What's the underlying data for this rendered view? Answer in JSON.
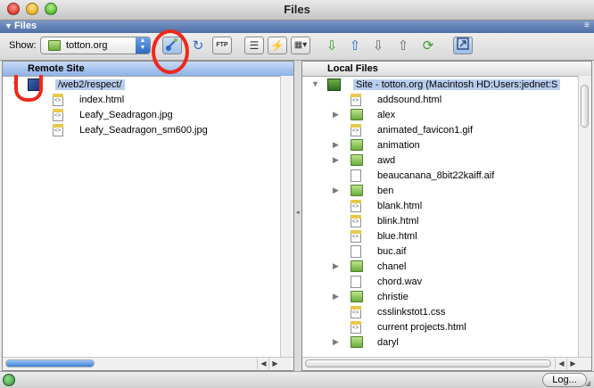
{
  "window": {
    "title": "Files"
  },
  "panel": {
    "label": "Files"
  },
  "toolbar": {
    "show_label": "Show:",
    "site_value": "totton.org",
    "ftp_label": "FTP",
    "buttons": [
      "connect-icon",
      "refresh-icon",
      "ftp-log-icon",
      "site-files-view-icon",
      "testing-server-icon",
      "repository-view-icon",
      "get-icon",
      "put-icon",
      "check-out-icon",
      "check-in-icon",
      "synchronize-icon",
      "expand-collapse-icon"
    ]
  },
  "remote": {
    "header": "Remote Site",
    "root": "/web2/respect/",
    "files": [
      "index.html",
      "Leafy_Seadragon.jpg",
      "Leafy_Seadragon_sm600.jpg"
    ]
  },
  "local": {
    "header": "Local Files",
    "root": "Site - totton.org (Macintosh HD:Users:jednet:S",
    "items": [
      {
        "name": "addsound.html",
        "type": "web",
        "expandable": false
      },
      {
        "name": "alex",
        "type": "folder",
        "expandable": true
      },
      {
        "name": "animated_favicon1.gif",
        "type": "web",
        "expandable": false
      },
      {
        "name": "animation",
        "type": "folder",
        "expandable": true
      },
      {
        "name": "awd",
        "type": "folder",
        "expandable": true
      },
      {
        "name": "beaucanana_8bit22kaiff.aif",
        "type": "file",
        "expandable": false
      },
      {
        "name": "ben",
        "type": "folder",
        "expandable": true
      },
      {
        "name": "blank.html",
        "type": "web",
        "expandable": false
      },
      {
        "name": "blink.html",
        "type": "web",
        "expandable": false
      },
      {
        "name": "blue.html",
        "type": "web",
        "expandable": false
      },
      {
        "name": "buc.aif",
        "type": "file",
        "expandable": false
      },
      {
        "name": "chanel",
        "type": "folder",
        "expandable": true
      },
      {
        "name": "chord.wav",
        "type": "file",
        "expandable": false
      },
      {
        "name": "christie",
        "type": "folder",
        "expandable": true
      },
      {
        "name": "csslinkstot1.css",
        "type": "web",
        "expandable": false
      },
      {
        "name": "current projects.html",
        "type": "web",
        "expandable": false
      },
      {
        "name": "daryl",
        "type": "folder",
        "expandable": true
      }
    ]
  },
  "status": {
    "log_label": "Log..."
  },
  "colors": {
    "annotation": "#f0281c",
    "selection": "#b7cdee"
  }
}
